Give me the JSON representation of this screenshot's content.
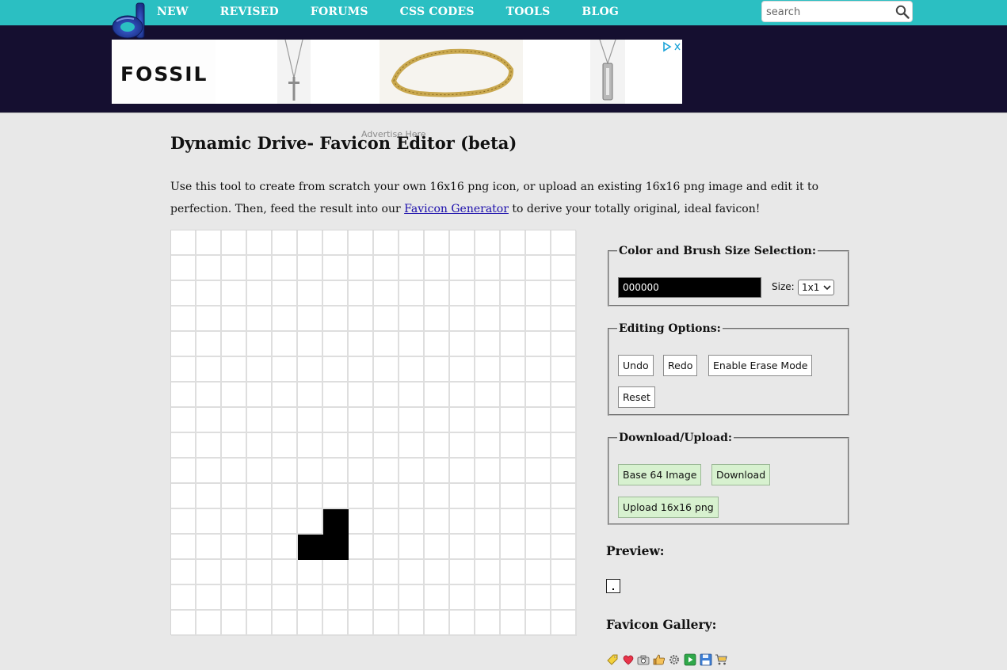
{
  "nav": {
    "items": [
      "NEW",
      "REVISED",
      "FORUMS",
      "CSS CODES",
      "TOOLS",
      "BLOG"
    ],
    "search_placeholder": "search",
    "colors": {
      "bar": "#2bbfc2",
      "logo": "#1f3d9e"
    }
  },
  "ad": {
    "brand": "FOSSIL",
    "advertise_label": "Advertise Here",
    "band_color": "#150f30"
  },
  "page": {
    "title": "Dynamic Drive- Favicon Editor (beta)",
    "intro_before": "Use this tool to create from scratch your own 16x16 png icon, or upload an existing 16x16 png image and edit it to perfection. Then, feed the result into our ",
    "intro_link": "Favicon Generator",
    "intro_after": " to derive your totally original, ideal favicon!"
  },
  "editor": {
    "grid_size": 16,
    "filled_cells": [
      [
        11,
        6
      ],
      [
        12,
        5
      ],
      [
        12,
        6
      ]
    ]
  },
  "color_panel": {
    "legend": "Color and Brush Size Selection:",
    "color_value": "000000",
    "size_label": "Size:",
    "size_selected": "1x1"
  },
  "editing_panel": {
    "legend": "Editing Options:",
    "undo": "Undo",
    "redo": "Redo",
    "erase": "Enable Erase Mode",
    "reset": "Reset"
  },
  "download_panel": {
    "legend": "Download/Upload:",
    "base64": "Base 64 Image",
    "download": "Download",
    "upload": "Upload 16x16 png"
  },
  "preview": {
    "heading": "Preview:"
  },
  "gallery": {
    "heading": "Favicon Gallery:",
    "icons": [
      "tag-icon",
      "heart-icon",
      "camera-icon",
      "thumbs-up-icon",
      "gear-icon",
      "play-icon",
      "floppy-disk-icon",
      "cart-icon"
    ]
  }
}
